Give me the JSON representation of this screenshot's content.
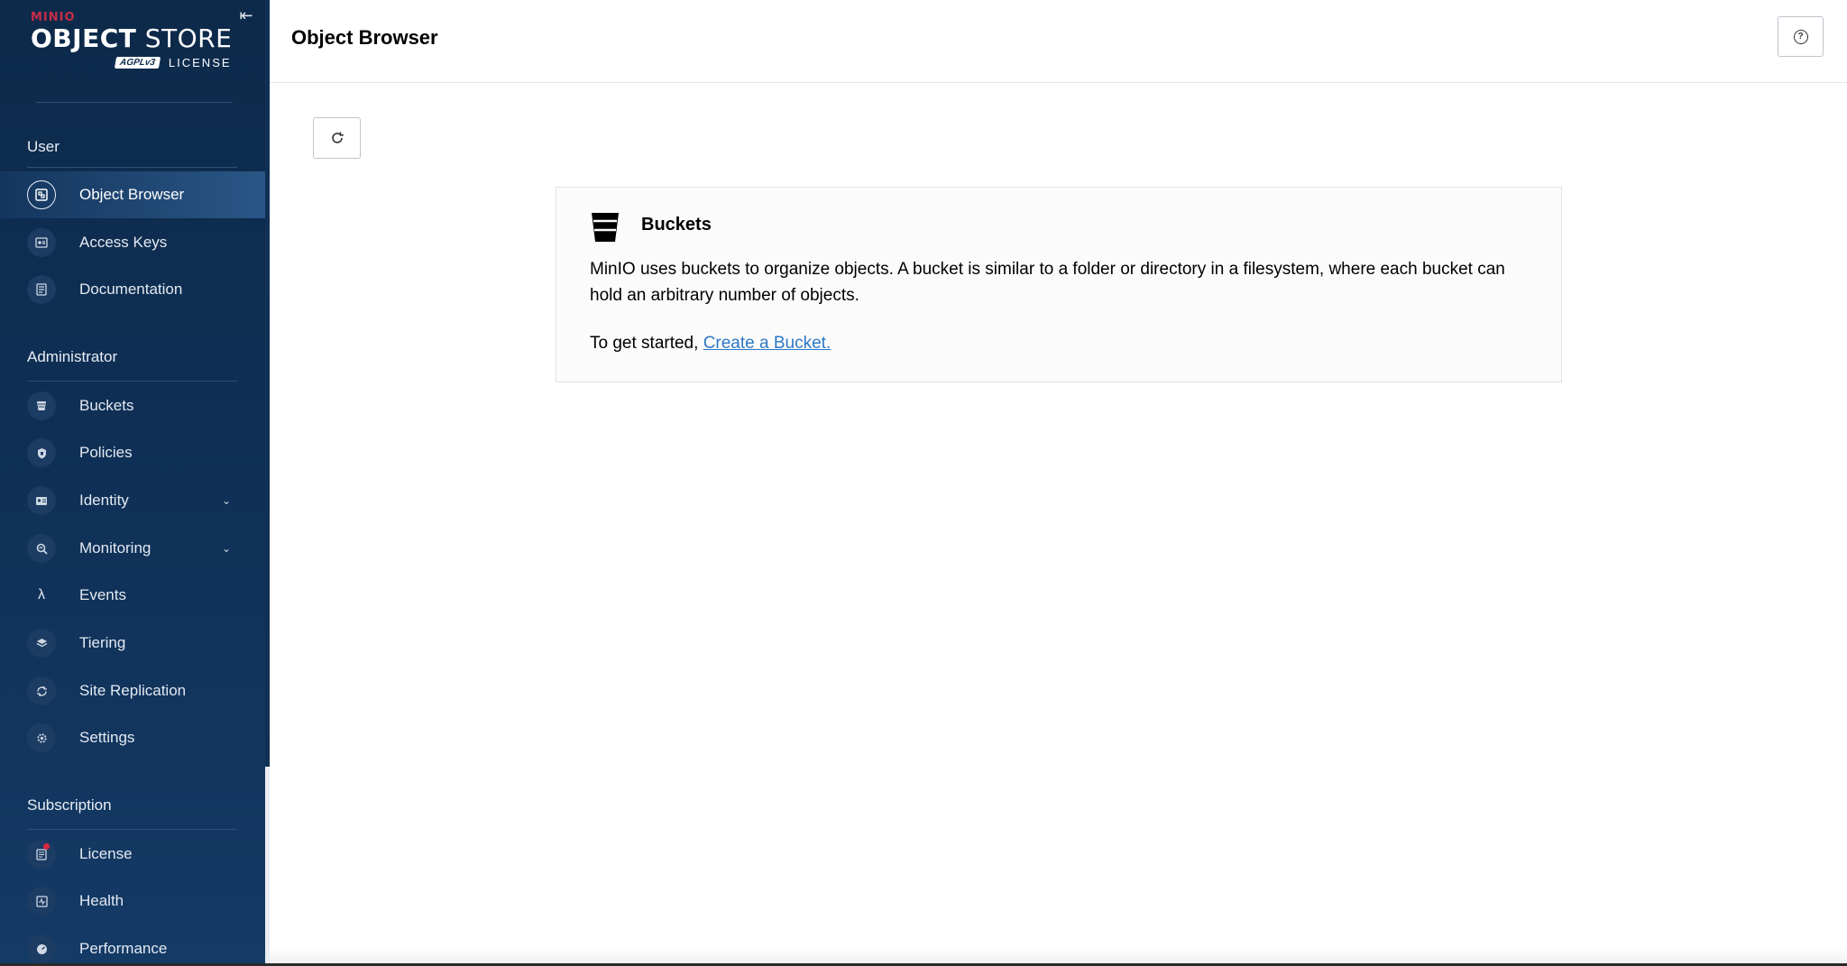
{
  "brand": {
    "minio": "MINIO",
    "product_bold": "OBJECT",
    "product_light": "STORE",
    "badge": "AGPLv3",
    "license_word": "LICENSE"
  },
  "sidebar": {
    "sections": [
      {
        "title": "User",
        "items": [
          {
            "label": "Object Browser",
            "icon": "object-browser-icon",
            "active": true
          },
          {
            "label": "Access Keys",
            "icon": "access-keys-icon"
          },
          {
            "label": "Documentation",
            "icon": "documentation-icon"
          }
        ]
      },
      {
        "title": "Administrator",
        "items": [
          {
            "label": "Buckets",
            "icon": "bucket-icon"
          },
          {
            "label": "Policies",
            "icon": "shield-icon"
          },
          {
            "label": "Identity",
            "icon": "identity-icon",
            "expandable": true
          },
          {
            "label": "Monitoring",
            "icon": "monitoring-icon",
            "expandable": true
          },
          {
            "label": "Events",
            "icon": "lambda-icon"
          },
          {
            "label": "Tiering",
            "icon": "layers-icon"
          },
          {
            "label": "Site Replication",
            "icon": "replication-icon"
          },
          {
            "label": "Settings",
            "icon": "gear-icon"
          }
        ]
      },
      {
        "title": "Subscription",
        "items": [
          {
            "label": "License",
            "icon": "license-icon",
            "notification": true
          },
          {
            "label": "Health",
            "icon": "health-icon"
          },
          {
            "label": "Performance",
            "icon": "performance-icon"
          }
        ]
      }
    ]
  },
  "header": {
    "title": "Object Browser"
  },
  "main": {
    "card": {
      "title": "Buckets",
      "description": "MinIO uses buckets to organize objects. A bucket is similar to a folder or directory in a filesystem, where each bucket can hold an arbitrary number of objects.",
      "cta_prefix": "To get started, ",
      "cta_link": "Create a Bucket."
    }
  },
  "colors": {
    "sidebar_bg": "#0f2f55",
    "link": "#2e78c7",
    "notification": "#d9263f"
  }
}
